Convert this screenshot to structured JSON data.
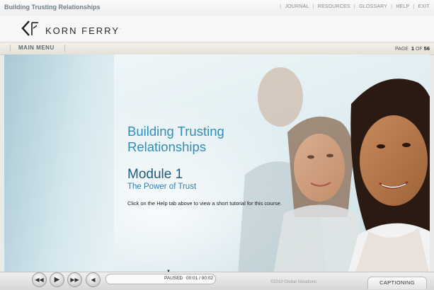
{
  "header": {
    "course_title": "Building Trusting Relationships",
    "links": [
      "JOURNAL",
      "RESOURCES",
      "GLOSSARY",
      "HELP",
      "EXIT"
    ]
  },
  "logo": {
    "text": "KORN FERRY",
    "mark": "·"
  },
  "menubar": {
    "main_menu": "MAIN MENU",
    "page_label": "PAGE",
    "page_current": "1",
    "page_of": "OF",
    "page_total": "56"
  },
  "stage": {
    "title_line1": "Building Trusting",
    "title_line2": "Relationships",
    "module": "Module 1",
    "module_subtitle": "The Power of Trust",
    "help_text": "Click on the Help tab above to view a short tutorial for this course."
  },
  "controls": {
    "rewind_icon": "rewind-icon",
    "play_icon": "play-icon",
    "forward_icon": "fast-forward-icon",
    "volume_icon": "volume-icon",
    "status": "PAUSED",
    "time": "00:01 / 00:02",
    "copyright": "©2010 Global Novations",
    "captioning": "CAPTIONING"
  },
  "colors": {
    "title_blue": "#2f8eb7",
    "module_blue": "#1d5b84",
    "header_text": "#6f7f8a"
  }
}
